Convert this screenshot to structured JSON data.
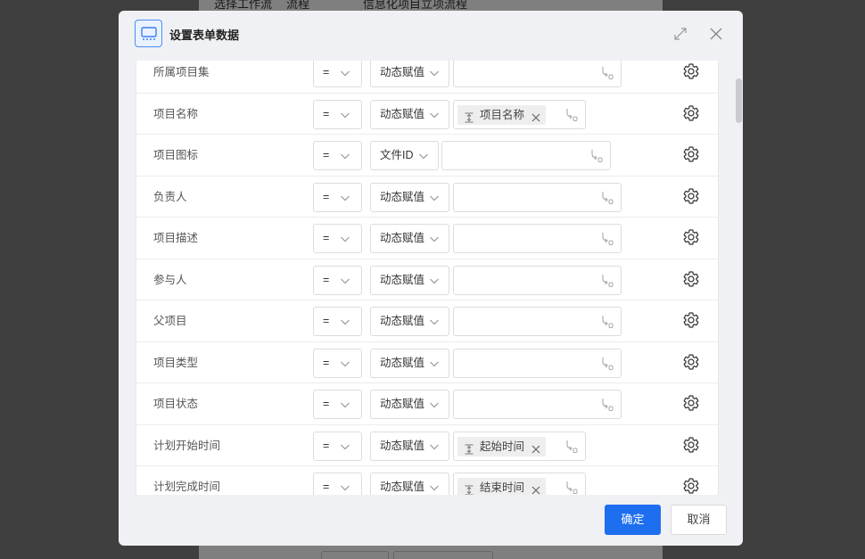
{
  "background": {
    "header_cells": [
      "选择工作流",
      "流程",
      "信息化项目立项流程"
    ]
  },
  "modal": {
    "title": "设置表单数据",
    "icons": {
      "title": "form-data-icon",
      "expand": "expand-icon",
      "close": "close-icon"
    }
  },
  "rows": [
    {
      "label": "所属项目集",
      "operator": "=",
      "mode": "动态赋值",
      "tag": null
    },
    {
      "label": "项目名称",
      "operator": "=",
      "mode": "动态赋值",
      "tag": "项目名称"
    },
    {
      "label": "项目图标",
      "operator": "=",
      "mode": "文件ID",
      "tag": null
    },
    {
      "label": "负责人",
      "operator": "=",
      "mode": "动态赋值",
      "tag": null
    },
    {
      "label": "项目描述",
      "operator": "=",
      "mode": "动态赋值",
      "tag": null
    },
    {
      "label": "参与人",
      "operator": "=",
      "mode": "动态赋值",
      "tag": null
    },
    {
      "label": "父项目",
      "operator": "=",
      "mode": "动态赋值",
      "tag": null
    },
    {
      "label": "项目类型",
      "operator": "=",
      "mode": "动态赋值",
      "tag": null
    },
    {
      "label": "项目状态",
      "operator": "=",
      "mode": "动态赋值",
      "tag": null
    },
    {
      "label": "计划开始时间",
      "operator": "=",
      "mode": "动态赋值",
      "tag": "起始时间"
    },
    {
      "label": "计划完成时间",
      "operator": "=",
      "mode": "动态赋值",
      "tag": "结束时间"
    }
  ],
  "footer": {
    "confirm_label": "确定",
    "cancel_label": "取消"
  }
}
